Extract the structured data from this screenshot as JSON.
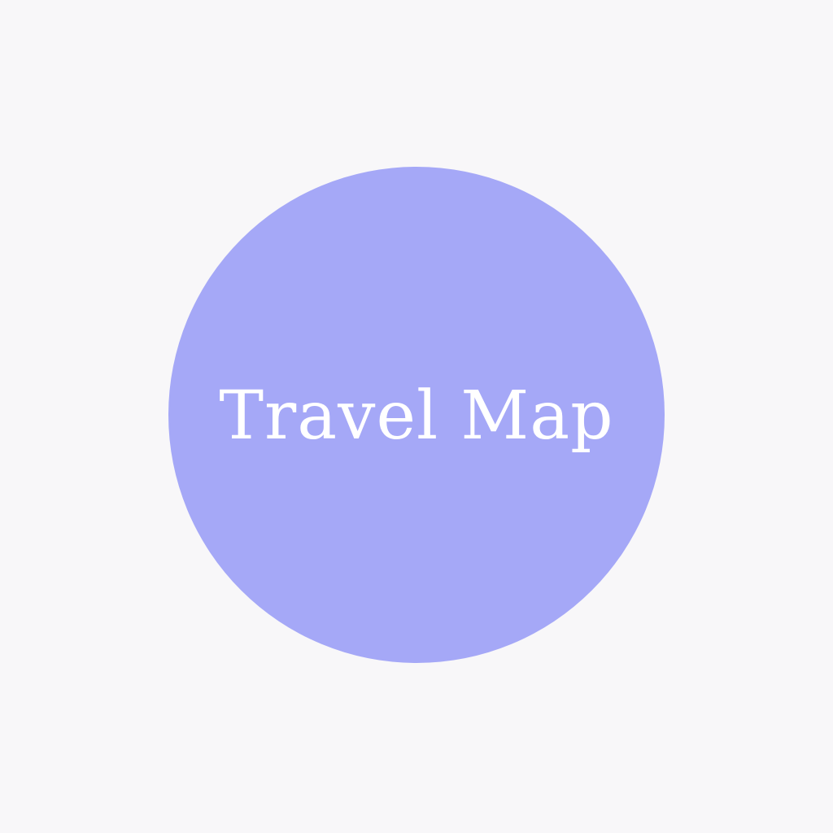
{
  "logo": {
    "title": "Travel Map",
    "background_color": "#f8f7f9",
    "circle_color": "#a5a8f7",
    "text_color": "#ffffff"
  }
}
